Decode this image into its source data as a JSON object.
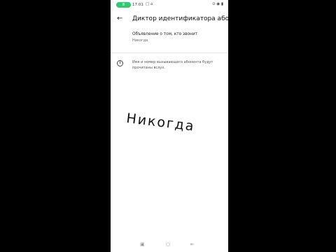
{
  "status_bar": {
    "pill_label": "8",
    "time": "17:01",
    "icons_left": "□ ⌂",
    "icons_right": "⊙ ◉ ▮"
  },
  "app_bar": {
    "back_icon": "arrow-back-icon",
    "title": "Диктор идентификатора або..."
  },
  "setting": {
    "title": "Объявление о том, кто звонит",
    "value": "Никогда"
  },
  "info": {
    "icon": "info-icon",
    "text": "Имя и номер вызывающего абонента будут прочитаны вслух."
  },
  "overlay_caption": "Никогда",
  "nav_bar": {
    "left": "▣",
    "center": "○",
    "right": "⇤"
  }
}
